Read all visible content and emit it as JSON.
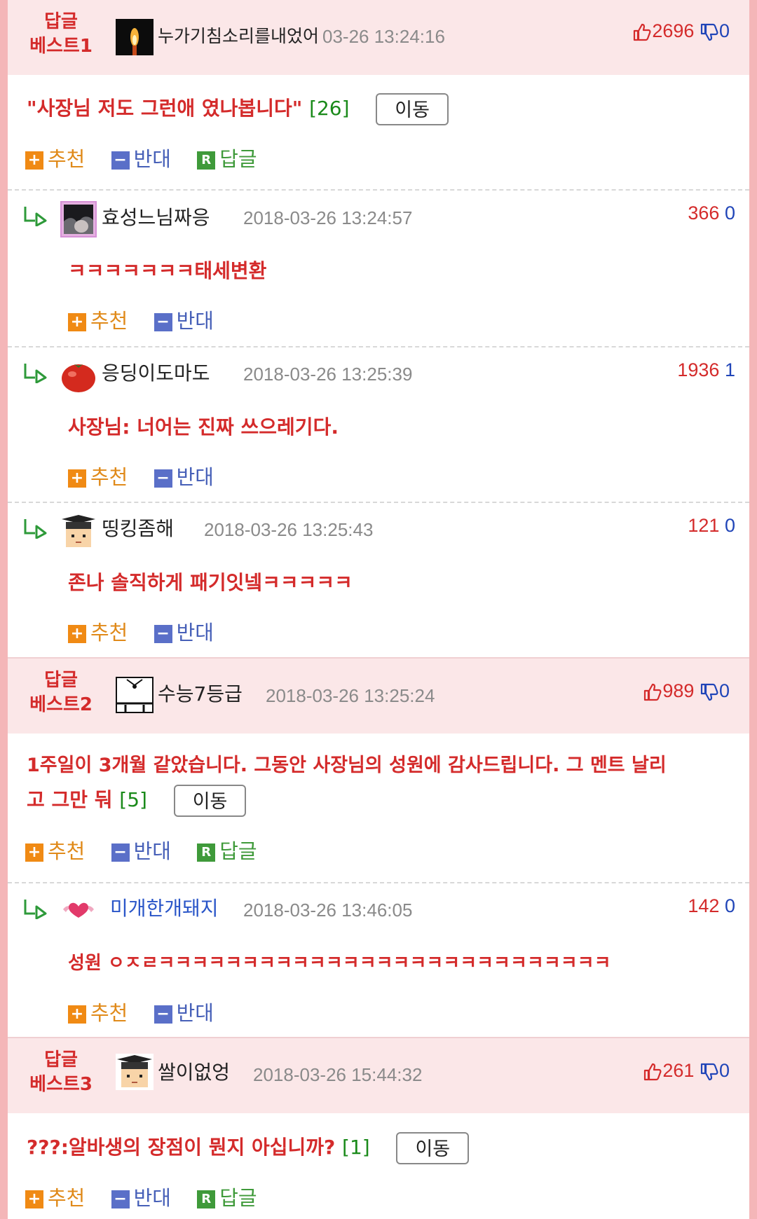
{
  "actions": {
    "recommend": "추천",
    "oppose": "반대",
    "reply": "답글",
    "move": "이동"
  },
  "best": [
    {
      "title_line1": "답글",
      "title_line2": "베스트1",
      "nick": "누가기침소리를내었어",
      "date": "03-26 13:24:16",
      "up": "2696",
      "down": "0",
      "text": "\"사장님 저도 그런애 였나봅니다\"",
      "count": "[26]",
      "replies": [
        {
          "nick": "효성느님짜응",
          "date": "2018-03-26 13:24:57",
          "up": "366",
          "down": "0",
          "text": "ㅋㅋㅋㅋㅋㅋㅋ태세변환"
        },
        {
          "nick": "응딩이도마도",
          "date": "2018-03-26 13:25:39",
          "up": "1936",
          "down": "1",
          "text": "사장님: 너어는 진짜 쓰으레기다."
        },
        {
          "nick": "띵킹좀해",
          "date": "2018-03-26 13:25:43",
          "up": "121",
          "down": "0",
          "text": "존나 솔직하게 패기잇넼ㅋㅋㅋㅋㅋ"
        }
      ]
    },
    {
      "title_line1": "답글",
      "title_line2": "베스트2",
      "nick": "수능7등급",
      "date": "2018-03-26 13:25:24",
      "up": "989",
      "down": "0",
      "text_line1": "1주일이 3개월 같았습니다. 그동안 사장님의 성원에 감사드립니다. 그 멘트 날리",
      "text_line2": "고 그만 둬",
      "count": "[5]",
      "replies": [
        {
          "nick": "미개한개돼지",
          "date": "2018-03-26 13:46:05",
          "up": "142",
          "down": "0",
          "text": "성원 ㅇㅈㄹㅋㅋㅋㅋㅋㅋㅋㅋㅋㅋㅋㅋㅋㅋㅋㅋㅋㅋㅋㅋㅋㅋㅋㅋㅋㅋㅋ"
        }
      ]
    },
    {
      "title_line1": "답글",
      "title_line2": "베스트3",
      "nick": "쌀이없엉",
      "date": "2018-03-26 15:44:32",
      "up": "261",
      "down": "0",
      "text": "???:알바생의 장점이 뭔지 아십니까?",
      "count": "[1]",
      "replies": []
    }
  ]
}
